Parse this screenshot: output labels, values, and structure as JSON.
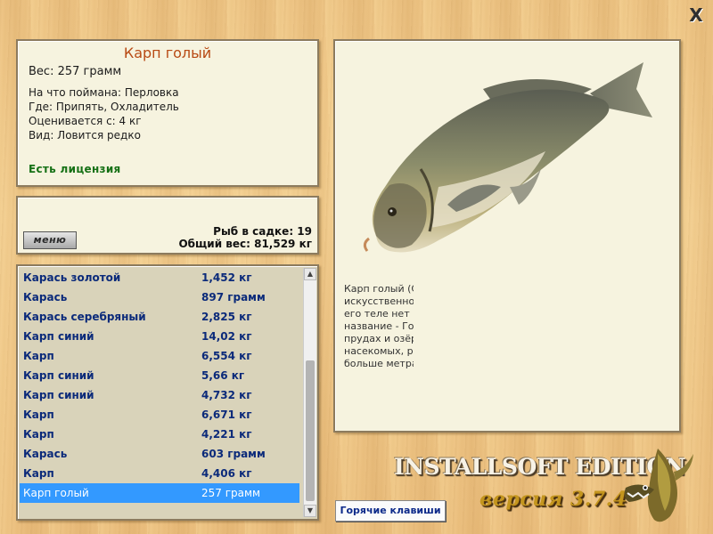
{
  "window": {
    "close_glyph": "X"
  },
  "fish": {
    "title": "Карп голый",
    "weight": "Вес: 257 грамм",
    "bait": "На что поймана: Перловка",
    "location": "Где: Припять, Охладитель",
    "valued_from": "Оценивается с: 4 кг",
    "kind": "Вид: Ловится редко",
    "license": "Есть лицензия"
  },
  "status": {
    "menu_label": "меню",
    "in_cage": "Рыб в садке: 19",
    "total_weight": "Общий вес: 81,529 кг"
  },
  "catch_list": [
    {
      "name": "Карась золотой",
      "weight": "1,452 кг"
    },
    {
      "name": "Карась",
      "weight": "897 грамм"
    },
    {
      "name": "Карась серебряный",
      "weight": "2,825 кг"
    },
    {
      "name": "Карп синий",
      "weight": "14,02 кг"
    },
    {
      "name": "Карп",
      "weight": "6,554 кг"
    },
    {
      "name": "Карп синий",
      "weight": "5,66 кг"
    },
    {
      "name": "Карп синий",
      "weight": "4,732 кг"
    },
    {
      "name": "Карп",
      "weight": "6,671 кг"
    },
    {
      "name": "Карп",
      "weight": "4,221 кг"
    },
    {
      "name": "Карась",
      "weight": "603 грамм"
    },
    {
      "name": "Карп",
      "weight": "4,406 кг"
    },
    {
      "name": "Карп голый",
      "weight": "257 грамм",
      "selected": true
    }
  ],
  "description_lines": [
    "Карп голый (С                                                    карпа. На",
    "искусственно                                                   получил",
    "его теле нет к                                                  ает в",
    "название - Го                                                   инками",
    "прудах и озёр                                                   ны",
    "насекомых, ра",
    "больше метра"
  ],
  "footer": {
    "hotkeys_label": "Горячие клавиши",
    "brand": "INSTALLSOFT EDITION",
    "version": "версия 3.7.4"
  },
  "icons": {
    "close": "close-icon",
    "fish": "carp-fish-image",
    "logo": "pike-logo-icon"
  },
  "colors": {
    "title": "#b84a14",
    "license": "#157015",
    "list_text": "#0b2a7a",
    "selection": "#3399ff",
    "brand_gold": "#c4961e"
  }
}
